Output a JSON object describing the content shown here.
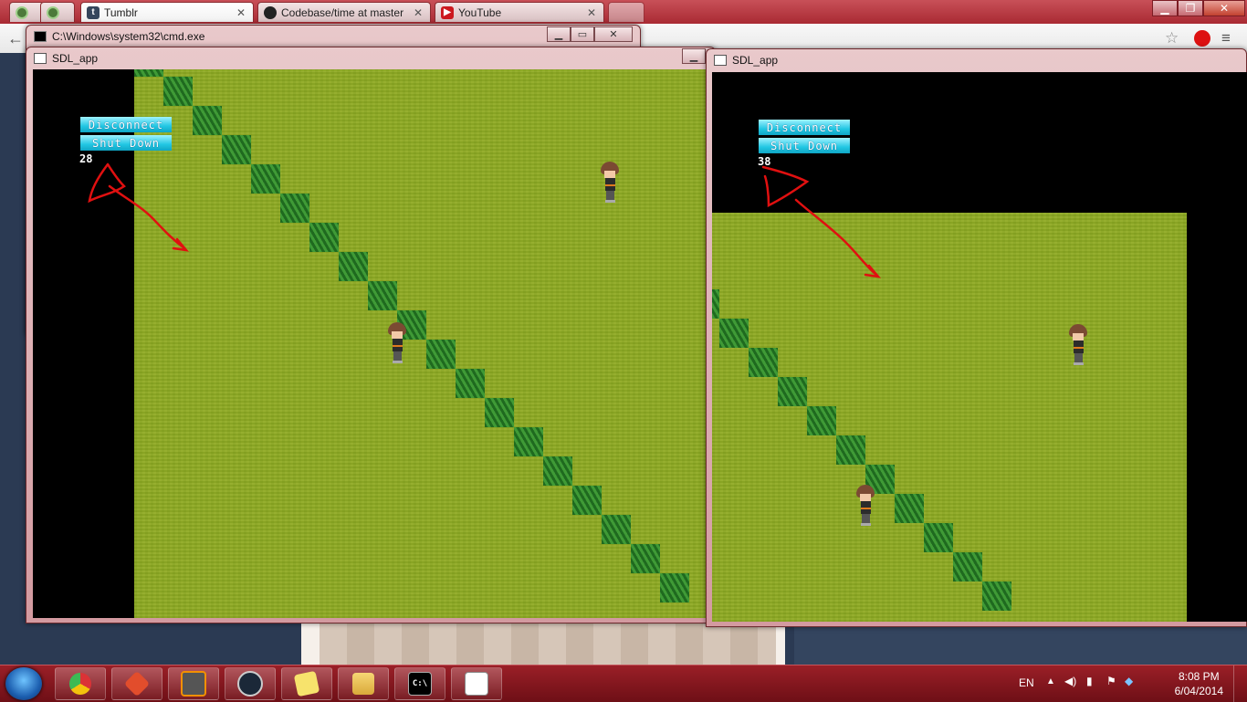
{
  "browser": {
    "tabs": [
      {
        "title": "Tumblr",
        "icon": "tumblr-icon",
        "color": "#35465c"
      },
      {
        "title": "Codebase/time at master",
        "icon": "github-icon",
        "color": "#222222"
      },
      {
        "title": "YouTube",
        "icon": "youtube-icon",
        "color": "#cc181e"
      }
    ]
  },
  "cmd_window": {
    "title": "C:\\Windows\\system32\\cmd.exe"
  },
  "sdl_left": {
    "title": "SDL_app",
    "buttons": {
      "disconnect": "Disconnect",
      "shutdown": "Shut Down"
    },
    "counter": "28"
  },
  "sdl_right": {
    "title": "SDL_app",
    "buttons": {
      "disconnect": "Disconnect",
      "shutdown": "Shut Down"
    },
    "counter": "38"
  },
  "taskbar": {
    "apps": [
      "chrome-icon",
      "git-icon",
      "sublime-icon",
      "steam-icon",
      "sticky-notes-icon",
      "explorer-icon",
      "cmd-icon",
      "sdl-app-icon"
    ],
    "language": "EN",
    "time": "8:08 PM",
    "date": "6/04/2014"
  },
  "colors": {
    "grass": "#8fa92a",
    "tall_grass": "#2f7f2a",
    "button_cyan": "#22c7e3",
    "annotation": "#e01010"
  }
}
